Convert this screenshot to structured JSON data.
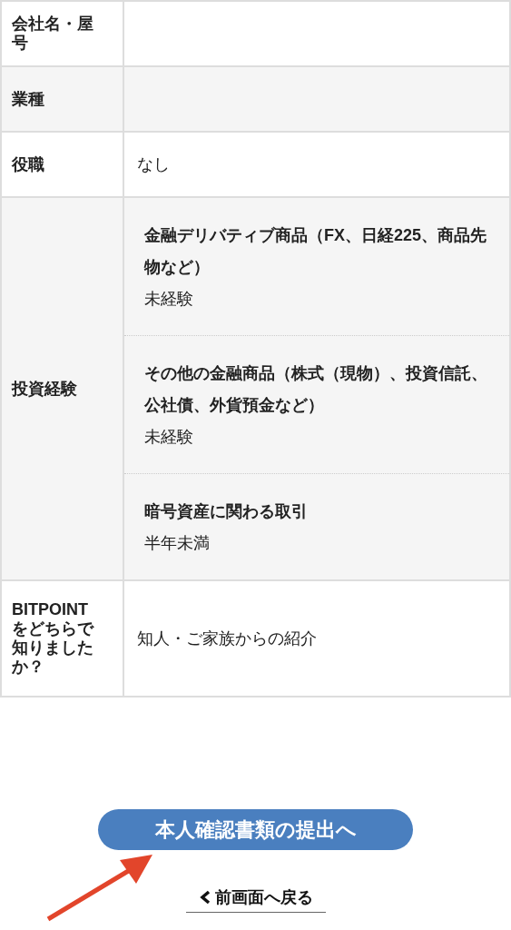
{
  "profile_table": {
    "rows": [
      {
        "kind": "plain",
        "label": "会社名・屋号",
        "value": ""
      },
      {
        "kind": "plain",
        "label": "業種",
        "value": ""
      },
      {
        "kind": "plain",
        "label": "役職",
        "value": "なし"
      },
      {
        "kind": "group",
        "label": "投資経験",
        "items": [
          {
            "title": "金融デリバティブ商品（FX、日経225、商品先物など）",
            "value": "未経験"
          },
          {
            "title": "その他の金融商品（株式（現物）、投資信託、公社債、外貨預金など）",
            "value": "未経験"
          },
          {
            "title": "暗号資産に関わる取引",
            "value": "半年未満"
          }
        ]
      },
      {
        "kind": "plain",
        "label": "BITPOINTをどちらで知りましたか？",
        "value": "知人・ご家族からの紹介"
      }
    ]
  },
  "submit_button": {
    "label": "本人確認書類の提出へ"
  },
  "back_link": {
    "label": "前画面へ戻る"
  }
}
